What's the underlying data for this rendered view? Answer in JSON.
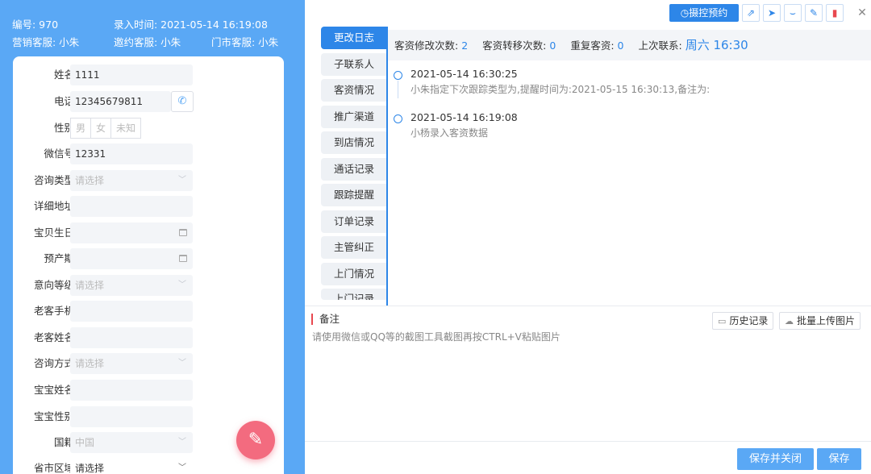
{
  "header": {
    "id_label": "编号: 970",
    "entry_time": "录入时间: 2021-05-14 16:19:08",
    "marketing": "营销客服: 小朱",
    "inviter": "邀约客服: 小朱",
    "store": "门市客服: 小朱"
  },
  "form": {
    "name": {
      "label": "姓名",
      "value": "1111"
    },
    "phone": {
      "label": "电话",
      "value": "12345679811"
    },
    "gender": {
      "label": "性别",
      "options": [
        "男",
        "女",
        "未知"
      ]
    },
    "wechat": {
      "label": "微信号",
      "value": "12331"
    },
    "consult_type": {
      "label": "咨询类型",
      "placeholder": "请选择"
    },
    "address": {
      "label": "详细地址",
      "value": ""
    },
    "baby_birthday": {
      "label": "宝贝生日",
      "value": ""
    },
    "due_date": {
      "label": "预产期",
      "value": ""
    },
    "intent_level": {
      "label": "意向等级",
      "placeholder": "请选择"
    },
    "old_phone": {
      "label": "老客手机",
      "value": ""
    },
    "old_name": {
      "label": "老客姓名",
      "value": ""
    },
    "consult_method": {
      "label": "咨询方式",
      "placeholder": "请选择"
    },
    "baby_name": {
      "label": "宝宝姓名",
      "value": ""
    },
    "baby_gender": {
      "label": "宝宝性别",
      "value": ""
    },
    "nationality": {
      "label": "国籍",
      "value": "中国"
    },
    "region": {
      "label": "省市区域",
      "value": "请选择"
    }
  },
  "toolbar": {
    "appointment_label": "摄控预约",
    "icons": [
      "external-link-icon",
      "send-icon",
      "handshake-icon",
      "edit-icon",
      "trash-icon",
      "close-icon"
    ],
    "close_glyph": "✕"
  },
  "tabs": [
    "更改日志",
    "子联系人",
    "客资情况",
    "推广渠道",
    "到店情况",
    "通话记录",
    "跟踪提醒",
    "订单记录",
    "主管纠正",
    "上门情况",
    "上门记录"
  ],
  "stats": {
    "modify_label": "客资修改次数:",
    "modify_value": "2",
    "transfer_label": "客资转移次数:",
    "transfer_value": "0",
    "duplicate_label": "重复客资:",
    "duplicate_value": "0",
    "last_contact_label": "上次联系:",
    "last_contact_value": "周六 16:30"
  },
  "log": [
    {
      "time": "2021-05-14 16:30:25",
      "text": "小朱指定下次跟踪类型为,提醒时间为:2021-05-15 16:30:13,备注为:"
    },
    {
      "time": "2021-05-14 16:19:08",
      "text": "小杨录入客资数据"
    }
  ],
  "notes": {
    "title": "备注",
    "hint": "请使用微信或QQ等的截图工具截图再按CTRL+V粘贴图片",
    "history_label": "历史记录",
    "upload_label": "批量上传图片"
  },
  "footer": {
    "save_close_label": "保存并关闭",
    "save_label": "保存"
  },
  "colors": {
    "accent": "#2d86e8",
    "panel": "#5aa8f5",
    "fab": "#f36b7f",
    "danger": "#e8484f"
  }
}
